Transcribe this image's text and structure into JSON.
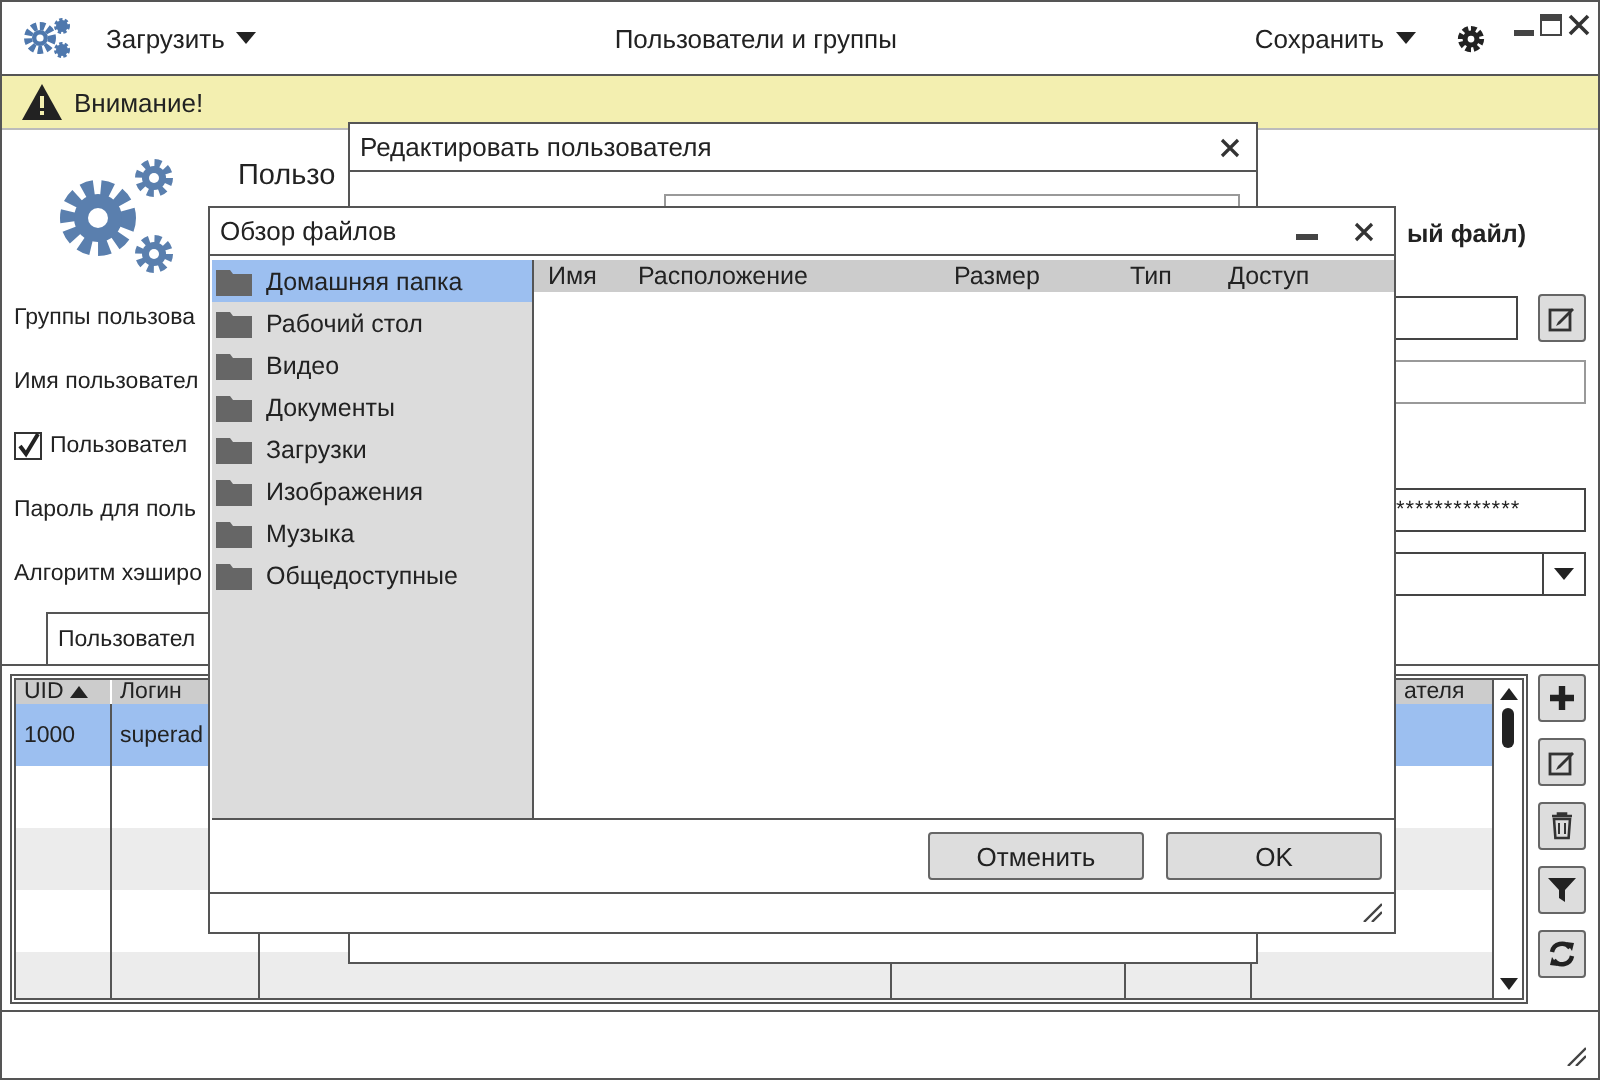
{
  "app": {
    "title": "Пользователи и группы",
    "load_menu": "Загрузить",
    "save_menu": "Сохранить"
  },
  "warning": {
    "text": "Внимание!"
  },
  "header": {
    "title": "Пользо",
    "subtitle": "ый файл)"
  },
  "form": {
    "groups_label": "Группы пользова",
    "username_label": "Имя пользовател",
    "user_checkbox": {
      "label": "Пользовател",
      "checked": true
    },
    "password_label": "Пароль для поль",
    "password_value": "*************",
    "hash_label": "Алгоритм хэширо"
  },
  "tabs": [
    {
      "label": "Пользовател",
      "selected": true
    }
  ],
  "table": {
    "columns": [
      "UID",
      "Логин",
      "ателя"
    ],
    "rows": [
      {
        "uid": "1000",
        "login": "superad",
        "selected": true
      }
    ]
  },
  "edit_dialog": {
    "title": "Редактировать пользователя"
  },
  "file_dialog": {
    "title": "Обзор файлов",
    "places": [
      {
        "label": "Домашняя папка",
        "selected": true
      },
      {
        "label": "Рабочий стол",
        "selected": false
      },
      {
        "label": "Видео",
        "selected": false
      },
      {
        "label": "Документы",
        "selected": false
      },
      {
        "label": "Загрузки",
        "selected": false
      },
      {
        "label": "Изображения",
        "selected": false
      },
      {
        "label": "Музыка",
        "selected": false
      },
      {
        "label": "Общедоступные",
        "selected": false
      }
    ],
    "columns": [
      "Имя",
      "Расположение",
      "Размер",
      "Тип",
      "Доступ"
    ],
    "buttons": [
      "Отменить",
      "OK"
    ]
  }
}
